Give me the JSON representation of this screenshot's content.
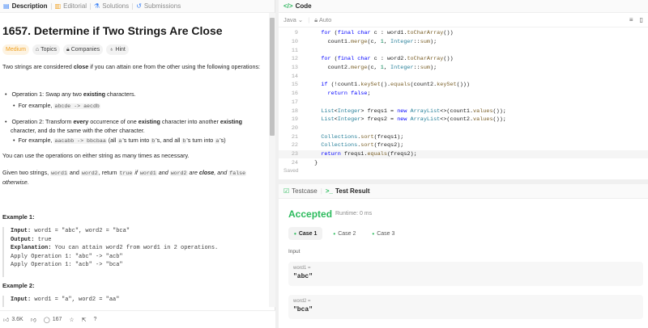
{
  "left_tabs": [
    {
      "label": "Description",
      "icon": "document-icon"
    },
    {
      "label": "Editorial",
      "icon": "book-icon"
    },
    {
      "label": "Solutions",
      "icon": "flask-icon"
    },
    {
      "label": "Submissions",
      "icon": "history-icon"
    }
  ],
  "problem": {
    "title": "1657. Determine if Two Strings Are Close",
    "difficulty": "Medium",
    "chips": [
      "Topics",
      "Companies",
      "Hint"
    ],
    "intro_1": "Two strings are considered ",
    "intro_bold": "close",
    "intro_2": " if you can attain one from the other using the following operations:",
    "op1_a": "Operation 1: Swap any two ",
    "op1_bold": "existing",
    "op1_b": " characters.",
    "op1_ex_prefix": "For example, ",
    "op1_ex_code": "abcde -> aecdb",
    "op2_a": "Operation 2: Transform ",
    "op2_bold1": "every",
    "op2_b": " occurrence of one ",
    "op2_bold2": "existing",
    "op2_c": " character into another ",
    "op2_bold3": "existing",
    "op2_d": " character, and do the same with the other character.",
    "op2_ex_prefix": "For example, ",
    "op2_ex_code": "aacabb -> bbcbaa",
    "op2_ex_text": " (all ",
    "op2_ex_a": "a",
    "op2_ex_text2": "'s turn into ",
    "op2_ex_b": "b",
    "op2_ex_text3": "'s, and all ",
    "op2_ex_b2": "b",
    "op2_ex_text4": "'s turn into ",
    "op2_ex_a2": "a",
    "op2_ex_text5": "'s)",
    "para_ops": "You can use the operations on either string as many times as necessary.",
    "given_1": "Given two strings, ",
    "given_w1": "word1",
    "given_2": " and ",
    "given_w2": "word2",
    "given_3": ", return ",
    "given_true": "true",
    "given_4": " if ",
    "given_w1b": "word1",
    "given_5": " and ",
    "given_w2b": "word2",
    "given_6": " are ",
    "given_close": "close",
    "given_7": ", and ",
    "given_false": "false",
    "given_8": " otherwise.",
    "example1_head": "Example 1:",
    "example1_input_label": "Input:",
    "example1_input": " word1 = \"abc\", word2 = \"bca\"",
    "example1_output_label": "Output:",
    "example1_output": " true",
    "example1_expl_label": "Explanation:",
    "example1_expl": " You can attain word2 from word1 in 2 operations.",
    "example1_line4": "Apply Operation 1: \"abc\" -> \"acb\"",
    "example1_line5": "Apply Operation 1: \"acb\" -> \"bca\"",
    "example2_head": "Example 2:",
    "example2_input_label": "Input:",
    "example2_input": " word1 = \"a\", word2 = \"aa\""
  },
  "footer": {
    "likes": "3.6K",
    "comments": "167"
  },
  "code_panel": {
    "title": "Code",
    "language": "Java",
    "mode": "Auto",
    "saved": "Saved",
    "lines": [
      {
        "n": "9",
        "src": "    for (final char c : word1.toCharArray())"
      },
      {
        "n": "10",
        "src": "      count1.merge(c, 1, Integer::sum);"
      },
      {
        "n": "11",
        "src": ""
      },
      {
        "n": "12",
        "src": "    for (final char c : word2.toCharArray())"
      },
      {
        "n": "13",
        "src": "      count2.merge(c, 1, Integer::sum);"
      },
      {
        "n": "14",
        "src": ""
      },
      {
        "n": "15",
        "src": "    if (!count1.keySet().equals(count2.keySet()))"
      },
      {
        "n": "16",
        "src": "      return false;"
      },
      {
        "n": "17",
        "src": ""
      },
      {
        "n": "18",
        "src": "    List<Integer> freqs1 = new ArrayList<>(count1.values());"
      },
      {
        "n": "19",
        "src": "    List<Integer> freqs2 = new ArrayList<>(count2.values());"
      },
      {
        "n": "20",
        "src": ""
      },
      {
        "n": "21",
        "src": "    Collections.sort(freqs1);"
      },
      {
        "n": "22",
        "src": "    Collections.sort(freqs2);"
      },
      {
        "n": "23",
        "src": "    return freqs1.equals(freqs2);"
      },
      {
        "n": "24",
        "src": "  }"
      }
    ]
  },
  "test_panel": {
    "tab_testcase": "Testcase",
    "tab_result": "Test Result",
    "status": "Accepted",
    "runtime": "Runtime: 0 ms",
    "cases": [
      "Case 1",
      "Case 2",
      "Case 3"
    ],
    "input_label": "Input",
    "vars": [
      {
        "name": "word1 =",
        "value": "\"abc\""
      },
      {
        "name": "word2 =",
        "value": "\"bca\""
      }
    ]
  }
}
